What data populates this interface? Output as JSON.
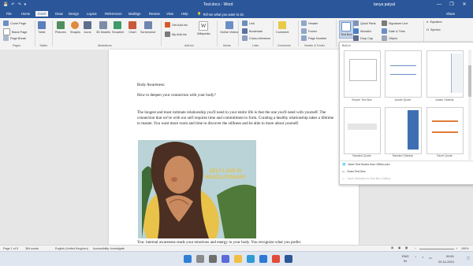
{
  "window": {
    "title": "Test.docx - Word",
    "user": "tanya patyal",
    "minimize": "—",
    "restore": "❐",
    "close": "✕",
    "quick_access": {
      "save": "💾",
      "undo": "↶",
      "redo": "↷",
      "more": "▾"
    }
  },
  "tabs": {
    "items": [
      "File",
      "Home",
      "Insert",
      "Draw",
      "Design",
      "Layout",
      "References",
      "Mailings",
      "Review",
      "View",
      "Help"
    ],
    "active": "Insert",
    "tell_me": "Tell me what you want to do",
    "share": "Share"
  },
  "ribbon": {
    "pages": {
      "label": "Pages",
      "items": [
        "Cover Page",
        "Blank Page",
        "Page Break"
      ]
    },
    "tables": {
      "label": "Tables",
      "items": [
        "Table"
      ]
    },
    "illustrations": {
      "label": "Illustrations",
      "items": [
        "Pictures",
        "Shapes",
        "Icons",
        "3D Models",
        "SmartArt",
        "Chart",
        "Screenshot"
      ]
    },
    "addins": {
      "label": "Add-ins",
      "items": [
        "Get Add-ins",
        "My Add-ins",
        "Wikipedia"
      ]
    },
    "media": {
      "label": "Media",
      "items": [
        "Online Videos"
      ]
    },
    "links": {
      "label": "Links",
      "items": [
        "Link",
        "Bookmark",
        "Cross-reference"
      ]
    },
    "comments": {
      "label": "Comments",
      "items": [
        "Comment"
      ]
    },
    "header_footer": {
      "label": "Header & Footer",
      "items": [
        "Header",
        "Footer",
        "Page Number"
      ]
    },
    "text": {
      "label": "Text",
      "items": [
        "Text Box",
        "Quick Parts",
        "WordArt",
        "Drop Cap",
        "Signature Line",
        "Date & Time",
        "Object"
      ]
    },
    "symbols": {
      "label": "Symbols",
      "items": [
        "Equation",
        "Symbol"
      ]
    }
  },
  "document": {
    "heading": "Body Awareness:",
    "question": "How to deepen your connection with your body?",
    "paragraph": "The longest and most intimate relationship you'll need in your entire life is that the one you'll need with yourself. The connection that we've with our self requires time and commitment to form. Curating a healthy relationship takes a lifetime to master. You want more room and time to discover the stillness and be able to more about yourself.",
    "image_text": "SELF LOVE IS REVOLUTIONARY",
    "bottom_line": "You: internal awareness reads your emotions and energy in your body. You recognize what you prefer."
  },
  "textbox_dropdown": {
    "section": "Built-in",
    "captions": [
      "Simple Text Box",
      "Austin Quote",
      "Austin Sidebar",
      "Banded Quote",
      "Banded Sidebar",
      "Facet Quote"
    ],
    "menu": [
      "More Text Boxes from Office.com",
      "Draw Text Box",
      "Save Selection to Text Box Gallery"
    ]
  },
  "statusbar": {
    "page": "Page 1 of 5",
    "words": "384 words",
    "language": "English (United Kingdom)",
    "accessibility": "Accessibility: Investigate",
    "zoom": "100%"
  },
  "taskbar": {
    "tray": {
      "lang": "ENG",
      "region": "IN",
      "time": "09:51",
      "date": "29-11-2021"
    }
  },
  "colors": {
    "word_blue": "#2b579a",
    "ribbon_bg": "#f3f3f3",
    "workspace": "#e6e6e6"
  }
}
